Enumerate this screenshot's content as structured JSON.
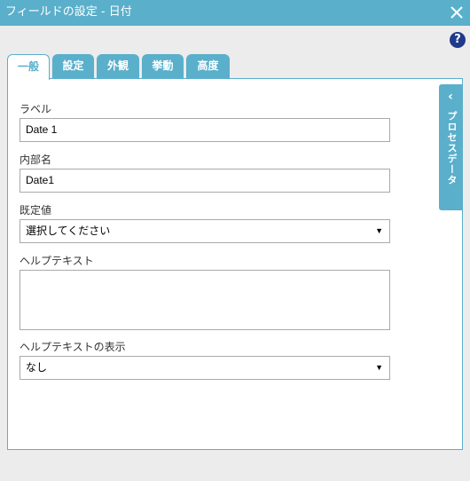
{
  "window": {
    "title": "フィールドの設定 - 日付"
  },
  "icons": {
    "close": "close-icon",
    "help": "help-icon",
    "chevron": "chevron-left-icon"
  },
  "help": {
    "glyph": "?"
  },
  "tabs": [
    {
      "label": "一般",
      "active": true
    },
    {
      "label": "設定",
      "active": false
    },
    {
      "label": "外観",
      "active": false
    },
    {
      "label": "挙動",
      "active": false
    },
    {
      "label": "高度",
      "active": false
    }
  ],
  "form": {
    "label_caption": "ラベル",
    "label_value": "Date 1",
    "internal_name_caption": "内部名",
    "internal_name_value": "Date1",
    "default_caption": "既定値",
    "default_value": "選択してください",
    "help_text_caption": "ヘルプテキスト",
    "help_text_value": "",
    "help_display_caption": "ヘルプテキストの表示",
    "help_display_value": "なし"
  },
  "side_panel": {
    "label": "プロセスデータ",
    "chevron": "‹"
  },
  "colors": {
    "accent": "#5aafcb",
    "help": "#1f3a8a",
    "background": "#ececec"
  }
}
